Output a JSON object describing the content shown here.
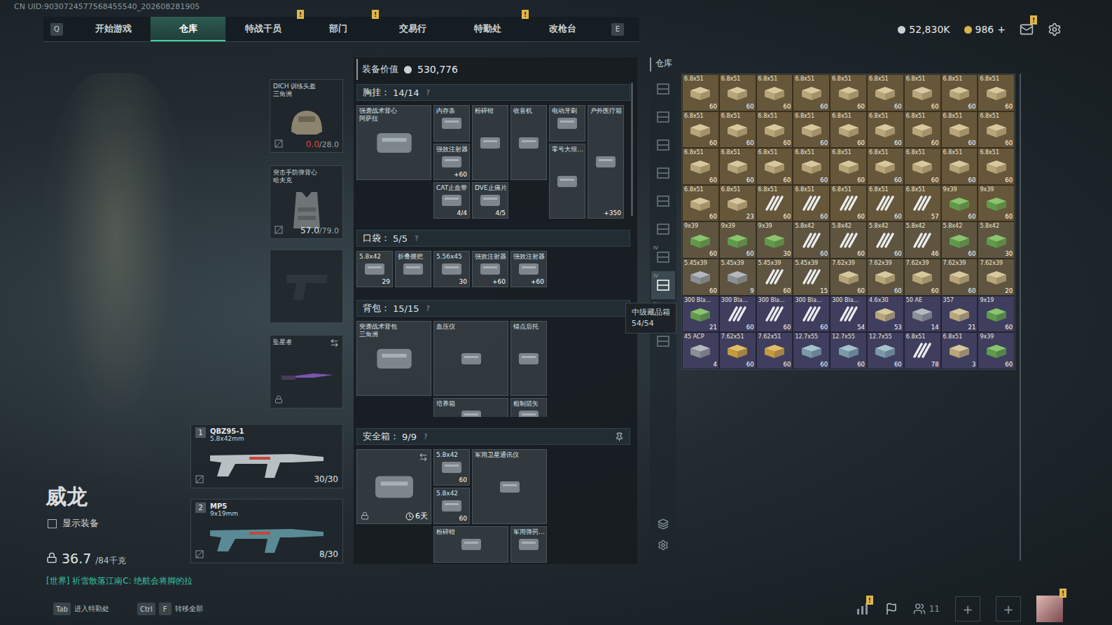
{
  "uid": "CN UID:9030724577568455540_202608281905",
  "nav": {
    "prev_key": "Q",
    "next_key": "E",
    "alert_mark": "!",
    "tabs": [
      {
        "label": "开始游戏",
        "selected": false,
        "alert": false
      },
      {
        "label": "仓库",
        "selected": true,
        "alert": false
      },
      {
        "label": "特战干员",
        "selected": false,
        "alert": true
      },
      {
        "label": "部门",
        "selected": false,
        "alert": true
      },
      {
        "label": "交易行",
        "selected": false,
        "alert": false
      },
      {
        "label": "特勤处",
        "selected": false,
        "alert": true
      },
      {
        "label": "改枪台",
        "selected": false,
        "alert": false
      }
    ]
  },
  "currency": {
    "coins": "52,830K",
    "gold": "986",
    "add": "+",
    "mail_alert": true
  },
  "operator": {
    "name": "威龙",
    "show_gear": {
      "label": "显示装备",
      "checked": false
    },
    "weight": "36.7",
    "capacity": "/84千克"
  },
  "chat": "[世界] 祈雪散落江南C: 绝航会将脚的拉",
  "gear": {
    "helmet": {
      "name": "DICH 训练头盔",
      "sub": "三角洲",
      "durability": "0.0",
      "max": "/28.0",
      "critical": true
    },
    "armor": {
      "name": "突击手防弹背心",
      "sub": "哈夫克",
      "durability": "57.0",
      "max": "/79.0",
      "critical": false
    },
    "pistol": {
      "empty": true
    },
    "melee": {
      "name": "坠星者"
    },
    "weapons": [
      {
        "slot": "1",
        "name": "QBZ95-1",
        "caliber": "5.8x42mm",
        "ammo": "30/30"
      },
      {
        "slot": "2",
        "name": "MP5",
        "caliber": "9x19mm",
        "ammo": "8/30"
      }
    ]
  },
  "loadout": {
    "title": "装备价值",
    "value": "530,776",
    "help": "?",
    "chest": {
      "label": "胸挂：",
      "count": "14/14",
      "carrier": {
        "name": "强袭战术背心",
        "sub": "阿萨拉"
      },
      "items": [
        {
          "name": "内存条",
          "count": ""
        },
        {
          "name": "粉碎钳",
          "count": ""
        },
        {
          "name": "收音机",
          "count": ""
        },
        {
          "name": "电动牙刷",
          "count": ""
        },
        {
          "name": "户外医疗箱",
          "count": "+350"
        },
        {
          "name": "强效注射器",
          "count": "+60"
        },
        {
          "name": "零号大坝…",
          "count": ""
        },
        {
          "name": "CAT止血带",
          "count": "4/4"
        },
        {
          "name": "DVE止痛片",
          "count": "4/5"
        }
      ]
    },
    "pockets": {
      "label": "口袋：",
      "count": "5/5",
      "items": [
        {
          "name": "5.8x42",
          "count": "29"
        },
        {
          "name": "折叠握把",
          "count": ""
        },
        {
          "name": "5.56x45",
          "count": "30"
        },
        {
          "name": "强效注射器",
          "count": "+60"
        },
        {
          "name": "强效注射器",
          "count": "+60"
        }
      ]
    },
    "backpack": {
      "label": "背包：",
      "count": "15/15",
      "carrier": {
        "name": "突袭战术背包",
        "sub": "三角洲"
      },
      "items": [
        {
          "name": "血压仪",
          "count": ""
        },
        {
          "name": "锚点后托",
          "count": ""
        },
        {
          "name": "培养箱",
          "count": ""
        },
        {
          "name": "粗制箭矢",
          "count": ""
        }
      ]
    },
    "safe": {
      "label": "安全箱：",
      "count": "9/9",
      "timer": "6天",
      "locked": true,
      "items": [
        {
          "name": "5.8x42",
          "count": "60"
        },
        {
          "name": "5.8x42",
          "count": "60"
        },
        {
          "name": "军用卫星通讯仪",
          "count": ""
        },
        {
          "name": "粉碎钳",
          "count": ""
        },
        {
          "name": "军用弹药…",
          "count": ""
        }
      ]
    }
  },
  "tooltip": {
    "title": "中级藏品箱",
    "count": "54/54"
  },
  "warehouse": {
    "title": "仓库",
    "tabs": [
      {
        "selected": false,
        "mark": ""
      },
      {
        "selected": false,
        "mark": ""
      },
      {
        "selected": false,
        "mark": ""
      },
      {
        "selected": false,
        "mark": ""
      },
      {
        "selected": false,
        "mark": ""
      },
      {
        "selected": false,
        "mark": ""
      },
      {
        "selected": false,
        "mark": "IV"
      },
      {
        "selected": true,
        "mark": "IV"
      },
      {
        "selected": false,
        "mark": "IV"
      },
      {
        "selected": false,
        "mark": ""
      }
    ],
    "items": [
      {
        "label": "6.8x51",
        "count": "60",
        "color": "#66563a",
        "kind": "tanbox"
      },
      {
        "label": "6.8x51",
        "count": "60",
        "color": "#66563a",
        "kind": "tanbox"
      },
      {
        "label": "6.8x51",
        "count": "60",
        "color": "#66563a",
        "kind": "tanbox"
      },
      {
        "label": "6.8x51",
        "count": "60",
        "color": "#66563a",
        "kind": "tanbox"
      },
      {
        "label": "6.8x51",
        "count": "60",
        "color": "#66563a",
        "kind": "tanbox"
      },
      {
        "label": "6.8x51",
        "count": "60",
        "color": "#66563a",
        "kind": "tanbox"
      },
      {
        "label": "6.8x51",
        "count": "60",
        "color": "#66563a",
        "kind": "tanbox"
      },
      {
        "label": "6.8x51",
        "count": "60",
        "color": "#66563a",
        "kind": "tanbox"
      },
      {
        "label": "6.8x51",
        "count": "60",
        "color": "#66563a",
        "kind": "tanbox"
      },
      {
        "label": "6.8x51",
        "count": "60",
        "color": "#66563a",
        "kind": "tanbox"
      },
      {
        "label": "6.8x51",
        "count": "60",
        "color": "#66563a",
        "kind": "tanbox"
      },
      {
        "label": "6.8x51",
        "count": "60",
        "color": "#66563a",
        "kind": "tanbox"
      },
      {
        "label": "6.8x51",
        "count": "60",
        "color": "#66563a",
        "kind": "tanbox"
      },
      {
        "label": "6.8x51",
        "count": "60",
        "color": "#66563a",
        "kind": "tanbox"
      },
      {
        "label": "6.8x51",
        "count": "60",
        "color": "#66563a",
        "kind": "tanbox"
      },
      {
        "label": "6.8x51",
        "count": "60",
        "color": "#66563a",
        "kind": "tanbox"
      },
      {
        "label": "6.8x51",
        "count": "60",
        "color": "#66563a",
        "kind": "tanbox"
      },
      {
        "label": "6.8x51",
        "count": "60",
        "color": "#66563a",
        "kind": "tanbox"
      },
      {
        "label": "6.8x51",
        "count": "60",
        "color": "#66563a",
        "kind": "tanbox"
      },
      {
        "label": "6.8x51",
        "count": "60",
        "color": "#66563a",
        "kind": "tanbox"
      },
      {
        "label": "6.8x51",
        "count": "60",
        "color": "#66563a",
        "kind": "tanbox"
      },
      {
        "label": "6.8x51",
        "count": "60",
        "color": "#66563a",
        "kind": "tanbox"
      },
      {
        "label": "6.8x51",
        "count": "60",
        "color": "#66563a",
        "kind": "tanbox"
      },
      {
        "label": "6.8x51",
        "count": "60",
        "color": "#66563a",
        "kind": "tanbox"
      },
      {
        "label": "6.8x51",
        "count": "60",
        "color": "#66563a",
        "kind": "tanbox"
      },
      {
        "label": "6.8x51",
        "count": "60",
        "color": "#66563a",
        "kind": "tanbox"
      },
      {
        "label": "6.8x51",
        "count": "60",
        "color": "#66563a",
        "kind": "tanbox"
      },
      {
        "label": "6.8x51",
        "count": "60",
        "color": "#66563a",
        "kind": "tanbox"
      },
      {
        "label": "6.8x51",
        "count": "23",
        "color": "#66563a",
        "kind": "tanbox"
      },
      {
        "label": "6.8x51",
        "count": "60",
        "color": "#66563a",
        "kind": "round"
      },
      {
        "label": "6.8x51",
        "count": "60",
        "color": "#66563a",
        "kind": "round"
      },
      {
        "label": "6.8x51",
        "count": "60",
        "color": "#66563a",
        "kind": "round"
      },
      {
        "label": "6.8x51",
        "count": "60",
        "color": "#66563a",
        "kind": "round"
      },
      {
        "label": "6.8x51",
        "count": "57",
        "color": "#66563a",
        "kind": "round"
      },
      {
        "label": "9x39",
        "count": "60",
        "color": "#66563a",
        "kind": "greenbox"
      },
      {
        "label": "9x39",
        "count": "60",
        "color": "#66563a",
        "kind": "greenbox"
      },
      {
        "label": "9x39",
        "count": "60",
        "color": "#5e5440",
        "kind": "greenbox"
      },
      {
        "label": "9x39",
        "count": "60",
        "color": "#5e5440",
        "kind": "greenbox"
      },
      {
        "label": "9x39",
        "count": "30",
        "color": "#5e5440",
        "kind": "greenbox"
      },
      {
        "label": "5.8x42",
        "count": "60",
        "color": "#5e5440",
        "kind": "round"
      },
      {
        "label": "5.8x42",
        "count": "60",
        "color": "#5e5440",
        "kind": "round"
      },
      {
        "label": "5.8x42",
        "count": "60",
        "color": "#5e5440",
        "kind": "round"
      },
      {
        "label": "5.8x42",
        "count": "46",
        "color": "#5e5440",
        "kind": "round"
      },
      {
        "label": "5.8x42",
        "count": "60",
        "color": "#5e5440",
        "kind": "greenbox"
      },
      {
        "label": "5.8x42",
        "count": "30",
        "color": "#5e5440",
        "kind": "greenbox"
      },
      {
        "label": "5.45x39",
        "count": "60",
        "color": "#5e5440",
        "kind": "graybox"
      },
      {
        "label": "5.45x39",
        "count": "9",
        "color": "#5e5440",
        "kind": "graybox"
      },
      {
        "label": "5.45x39",
        "count": "60",
        "color": "#5e5440",
        "kind": "round"
      },
      {
        "label": "5.45x39",
        "count": "15",
        "color": "#5e5440",
        "kind": "round"
      },
      {
        "label": "7.62x39",
        "count": "60",
        "color": "#5e5440",
        "kind": "tanbox"
      },
      {
        "label": "7.62x39",
        "count": "60",
        "color": "#5e5440",
        "kind": "tanbox"
      },
      {
        "label": "7.62x39",
        "count": "60",
        "color": "#5e5440",
        "kind": "tanbox"
      },
      {
        "label": "7.62x39",
        "count": "60",
        "color": "#5e5440",
        "kind": "tanbox"
      },
      {
        "label": "7.62x39",
        "count": "20",
        "color": "#5e5440",
        "kind": "tanbox"
      },
      {
        "label": "300 Bla...",
        "count": "21",
        "color": "#3f3e5e",
        "kind": "greenbox"
      },
      {
        "label": "300 Bla...",
        "count": "60",
        "color": "#3f3e5e",
        "kind": "round"
      },
      {
        "label": "300 Bla...",
        "count": "60",
        "color": "#3f3e5e",
        "kind": "round"
      },
      {
        "label": "300 Bla...",
        "count": "60",
        "color": "#3f3e5e",
        "kind": "round"
      },
      {
        "label": "300 Bla...",
        "count": "54",
        "color": "#3f3e5e",
        "kind": "round"
      },
      {
        "label": "4.6x30",
        "count": "53",
        "color": "#3f3e5e",
        "kind": "tanbox"
      },
      {
        "label": "50 AE",
        "count": "14",
        "color": "#3f3e5e",
        "kind": "graybox"
      },
      {
        "label": "357",
        "count": "21",
        "color": "#3f3e5e",
        "kind": "tanbox"
      },
      {
        "label": "9x19",
        "count": "60",
        "color": "#3f3e5e",
        "kind": "greenbox"
      },
      {
        "label": "45 ACP",
        "count": "4",
        "color": "#3f3e5e",
        "kind": "graybox"
      },
      {
        "label": "7.62x51",
        "count": "60",
        "color": "#3f3e5e",
        "kind": "goldbox"
      },
      {
        "label": "7.62x51",
        "count": "60",
        "color": "#3f3e5e",
        "kind": "goldbox"
      },
      {
        "label": "12.7x55",
        "count": "60",
        "color": "#3f3e5e",
        "kind": "bluebox"
      },
      {
        "label": "12.7x55",
        "count": "60",
        "color": "#3f3e5e",
        "kind": "bluebox"
      },
      {
        "label": "12.7x55",
        "count": "60",
        "color": "#3f3e5e",
        "kind": "bluebox"
      },
      {
        "label": "6.8x51",
        "count": "78",
        "color": "#3f3e5e",
        "kind": "round"
      },
      {
        "label": "6.8x51",
        "count": "3",
        "color": "#3f3e5e",
        "kind": "tanbox"
      },
      {
        "label": "9x39",
        "count": "60",
        "color": "#3f3e5e",
        "kind": "greenbox"
      }
    ]
  },
  "footer": {
    "shortcuts": [
      {
        "keys": [
          "Tab"
        ],
        "label": "进入特勤处"
      },
      {
        "keys": [
          "Ctrl",
          "F"
        ],
        "label": "转移全部"
      }
    ],
    "stats_alert": true,
    "friends": "11",
    "add": "+",
    "avatar_alert": true
  }
}
